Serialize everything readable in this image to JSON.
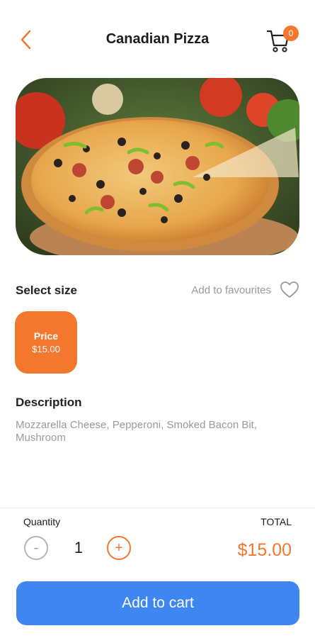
{
  "header": {
    "title": "Canadian Pizza",
    "cart_count": "0"
  },
  "product": {
    "image_alt": "pizza-photo"
  },
  "size": {
    "label": "Select size",
    "favourite_text": "Add to favourites",
    "option": {
      "label": "Price",
      "value": "$15.00"
    }
  },
  "description": {
    "title": "Description",
    "text": "Mozzarella Cheese, Pepperoni, Smoked Bacon Bit, Mushroom"
  },
  "order": {
    "quantity_label": "Quantity",
    "quantity_value": "1",
    "minus": "-",
    "plus": "+",
    "total_label": "TOTAL",
    "total_value": "$15.00",
    "button_label": "Add to cart"
  },
  "colors": {
    "accent": "#f4772e",
    "button": "#3f86f0"
  }
}
